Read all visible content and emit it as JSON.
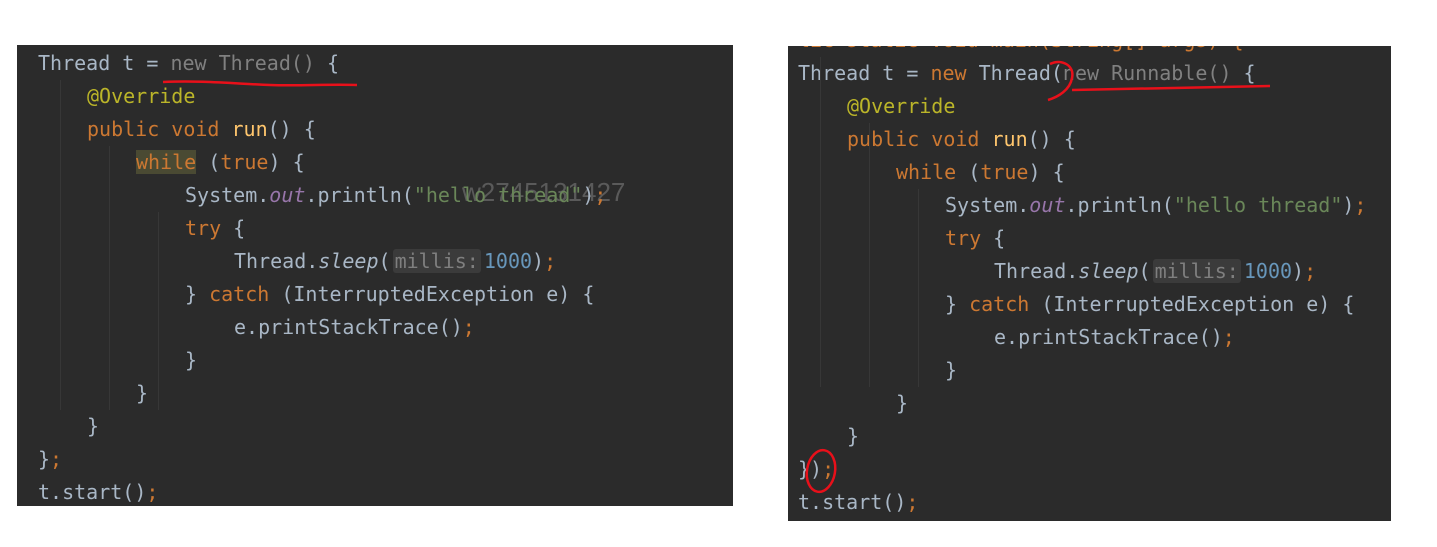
{
  "watermark": "w2745131427",
  "left_code": {
    "lines": [
      {
        "indent": 0,
        "tokens": [
          [
            "Thread t = ",
            ""
          ],
          [
            "new Thread()",
            "gray"
          ],
          [
            " {",
            ""
          ]
        ]
      },
      {
        "indent": 1,
        "tokens": [
          [
            "@Override",
            "ann"
          ]
        ]
      },
      {
        "indent": 1,
        "tokens": [
          [
            "public void ",
            "kw"
          ],
          [
            "run",
            "fn"
          ],
          [
            "() {",
            ""
          ]
        ]
      },
      {
        "indent": 2,
        "tokens": [
          [
            "while",
            "kw hl"
          ],
          [
            " (",
            ""
          ],
          [
            "true",
            "kw"
          ],
          [
            ") {",
            ""
          ]
        ]
      },
      {
        "indent": 3,
        "tokens": [
          [
            "System.",
            ""
          ],
          [
            "out",
            "fld"
          ],
          [
            ".println(",
            ""
          ],
          [
            "\"hello thread\"",
            "str"
          ],
          [
            ")",
            ""
          ],
          [
            ";",
            "kw"
          ]
        ]
      },
      {
        "indent": 3,
        "tokens": [
          [
            "try",
            "kw"
          ],
          [
            " {",
            ""
          ]
        ]
      },
      {
        "indent": 4,
        "tokens": [
          [
            "Thread.",
            ""
          ],
          [
            "sleep",
            "sfn"
          ],
          [
            "(",
            ""
          ],
          [
            "millis:",
            "hint"
          ],
          [
            "1000",
            "num"
          ],
          [
            ")",
            ""
          ],
          [
            ";",
            "kw"
          ]
        ]
      },
      {
        "indent": 3,
        "tokens": [
          [
            "} ",
            ""
          ],
          [
            "catch",
            "kw"
          ],
          [
            " (InterruptedException e) {",
            ""
          ]
        ]
      },
      {
        "indent": 4,
        "tokens": [
          [
            "e.printStackTrace()",
            ""
          ],
          [
            ";",
            "kw"
          ]
        ]
      },
      {
        "indent": 3,
        "tokens": [
          [
            "}",
            ""
          ]
        ]
      },
      {
        "indent": 2,
        "tokens": [
          [
            "}",
            ""
          ]
        ]
      },
      {
        "indent": 1,
        "tokens": [
          [
            "}",
            ""
          ]
        ]
      },
      {
        "indent": 0,
        "tokens": [
          [
            "}",
            ""
          ],
          [
            ";",
            "kw"
          ]
        ]
      },
      {
        "indent": 0,
        "tokens": [
          [
            "t.start()",
            ""
          ],
          [
            ";",
            "kw"
          ]
        ]
      }
    ]
  },
  "right_code": {
    "lines": [
      {
        "indent": 0,
        "tokens": [
          [
            "lic static void main(String[] args) {",
            "kw"
          ]
        ]
      },
      {
        "indent": 0,
        "tokens": [
          [
            "Thread t = ",
            ""
          ],
          [
            "new ",
            "kw"
          ],
          [
            "Thread(",
            ""
          ],
          [
            "new Runnable()",
            "gray"
          ],
          [
            " {",
            ""
          ]
        ]
      },
      {
        "indent": 1,
        "tokens": [
          [
            "@Override",
            "ann"
          ]
        ]
      },
      {
        "indent": 1,
        "tokens": [
          [
            "public void ",
            "kw"
          ],
          [
            "run",
            "fn"
          ],
          [
            "() {",
            ""
          ]
        ]
      },
      {
        "indent": 2,
        "tokens": [
          [
            "while",
            "kw"
          ],
          [
            " (",
            ""
          ],
          [
            "true",
            "kw"
          ],
          [
            ") {",
            ""
          ]
        ]
      },
      {
        "indent": 3,
        "tokens": [
          [
            "System.",
            ""
          ],
          [
            "out",
            "fld"
          ],
          [
            ".println(",
            ""
          ],
          [
            "\"hello thread\"",
            "str"
          ],
          [
            ")",
            ""
          ],
          [
            ";",
            "kw"
          ]
        ]
      },
      {
        "indent": 3,
        "tokens": [
          [
            "try",
            "kw"
          ],
          [
            " {",
            ""
          ]
        ]
      },
      {
        "indent": 4,
        "tokens": [
          [
            "Thread.",
            ""
          ],
          [
            "sleep",
            "sfn"
          ],
          [
            "(",
            ""
          ],
          [
            "millis:",
            "hint"
          ],
          [
            "1000",
            "num"
          ],
          [
            ")",
            ""
          ],
          [
            ";",
            "kw"
          ]
        ]
      },
      {
        "indent": 3,
        "tokens": [
          [
            "} ",
            ""
          ],
          [
            "catch",
            "kw"
          ],
          [
            " (InterruptedException e) {",
            ""
          ]
        ]
      },
      {
        "indent": 4,
        "tokens": [
          [
            "e.printStackTrace()",
            ""
          ],
          [
            ";",
            "kw"
          ]
        ]
      },
      {
        "indent": 3,
        "tokens": [
          [
            "}",
            ""
          ]
        ]
      },
      {
        "indent": 2,
        "tokens": [
          [
            "}",
            ""
          ]
        ]
      },
      {
        "indent": 1,
        "tokens": [
          [
            "}",
            ""
          ]
        ]
      },
      {
        "indent": 0,
        "tokens": [
          [
            "})",
            ""
          ],
          [
            ";",
            "kw"
          ]
        ]
      },
      {
        "indent": 0,
        "tokens": [
          [
            "t.start()",
            ""
          ],
          [
            ";",
            "kw"
          ]
        ]
      }
    ]
  },
  "colors": {
    "background": "#2b2b2b",
    "annotation_pen": "#e8101a"
  }
}
